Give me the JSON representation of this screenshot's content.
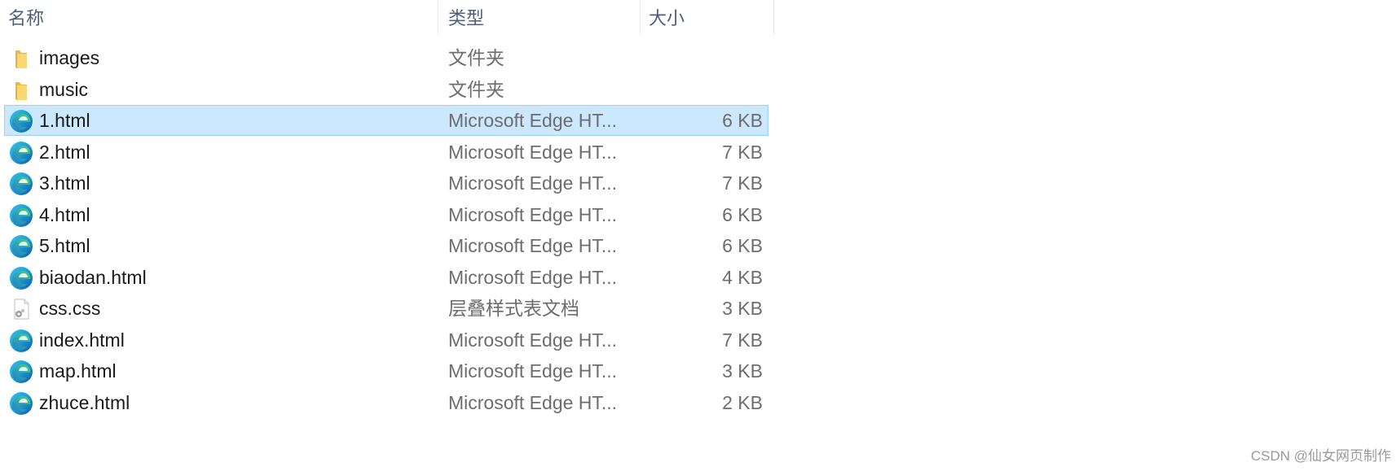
{
  "headers": {
    "name": "名称",
    "type": "类型",
    "size": "大小"
  },
  "files": [
    {
      "name": "images",
      "type": "文件夹",
      "size": "",
      "icon": "folder-icon",
      "selected": false
    },
    {
      "name": "music",
      "type": "文件夹",
      "size": "",
      "icon": "folder-icon",
      "selected": false
    },
    {
      "name": "1.html",
      "type": "Microsoft Edge HT...",
      "size": "6 KB",
      "icon": "edge-icon",
      "selected": true
    },
    {
      "name": "2.html",
      "type": "Microsoft Edge HT...",
      "size": "7 KB",
      "icon": "edge-icon",
      "selected": false
    },
    {
      "name": "3.html",
      "type": "Microsoft Edge HT...",
      "size": "7 KB",
      "icon": "edge-icon",
      "selected": false
    },
    {
      "name": "4.html",
      "type": "Microsoft Edge HT...",
      "size": "6 KB",
      "icon": "edge-icon",
      "selected": false
    },
    {
      "name": "5.html",
      "type": "Microsoft Edge HT...",
      "size": "6 KB",
      "icon": "edge-icon",
      "selected": false
    },
    {
      "name": "biaodan.html",
      "type": "Microsoft Edge HT...",
      "size": "4 KB",
      "icon": "edge-icon",
      "selected": false
    },
    {
      "name": "css.css",
      "type": "层叠样式表文档",
      "size": "3 KB",
      "icon": "css-file-icon",
      "selected": false
    },
    {
      "name": "index.html",
      "type": "Microsoft Edge HT...",
      "size": "7 KB",
      "icon": "edge-icon",
      "selected": false
    },
    {
      "name": "map.html",
      "type": "Microsoft Edge HT...",
      "size": "3 KB",
      "icon": "edge-icon",
      "selected": false
    },
    {
      "name": "zhuce.html",
      "type": "Microsoft Edge HT...",
      "size": "2 KB",
      "icon": "edge-icon",
      "selected": false
    }
  ],
  "watermark": "CSDN @仙女网页制作",
  "colors": {
    "selected_background": "#cce8ff",
    "selected_border": "#99d1ff",
    "header_text": "#4c5f7a",
    "secondary_text": "#6d6d6d"
  }
}
